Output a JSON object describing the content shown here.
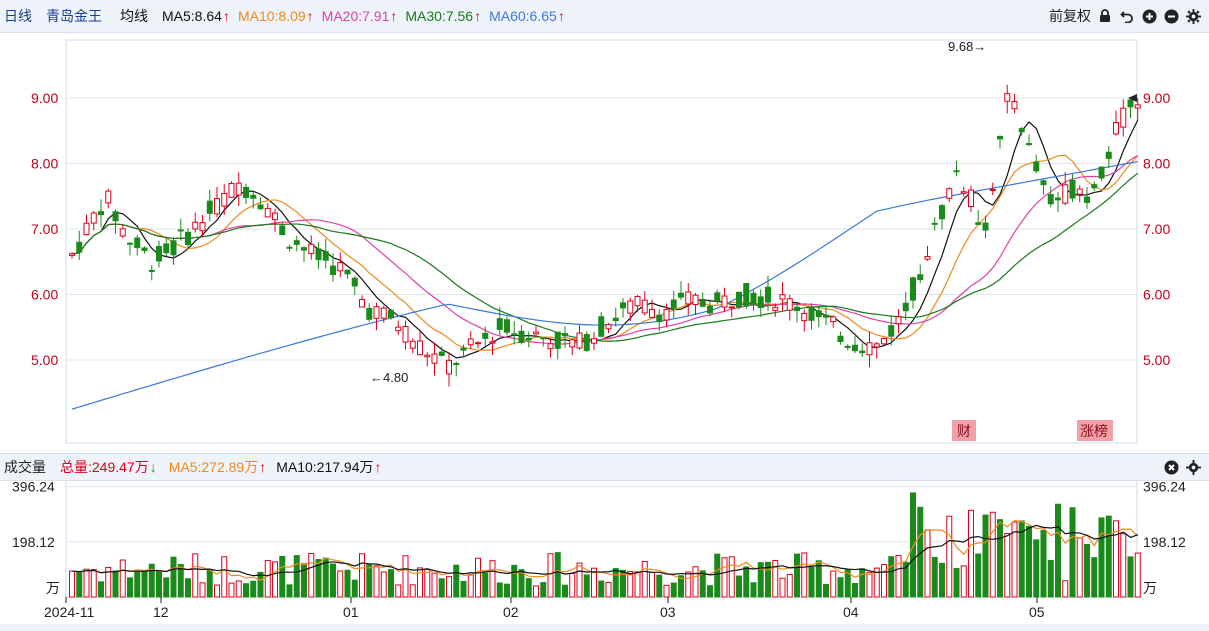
{
  "header": {
    "period": "日线",
    "stock_name": "青岛金王",
    "ma_title": "均线",
    "ma5": "MA5:8.64",
    "ma10": "MA10:8.09",
    "ma20": "MA20:7.91",
    "ma30": "MA30:7.56",
    "ma60": "MA60:6.65",
    "adjust": "前复权"
  },
  "volume_header": {
    "title": "成交量",
    "total": "总量:249.47万",
    "ma5": "MA5:272.89万",
    "ma10": "MA10:217.94万"
  },
  "colors": {
    "up": "#e0001b",
    "down": "#1a8a1a",
    "ma5": "#111111",
    "ma10": "#f08a1c",
    "ma20": "#e040a8",
    "ma30": "#1a7a1a",
    "ma60": "#3a7ad8"
  },
  "chart_data": [
    {
      "type": "candlestick",
      "y_ticks": [
        "5.00",
        "6.00",
        "7.00",
        "8.00",
        "9.00"
      ],
      "ylim": [
        4.0,
        9.9
      ],
      "annotations": {
        "high": "9.68→",
        "low": "←4.80",
        "badge1": "财",
        "badge2": "涨榜"
      },
      "grid": true
    },
    {
      "type": "bar",
      "y_ticks": [
        "396.24",
        "198.12"
      ],
      "unit": "万",
      "ylim": [
        0,
        420
      ],
      "x_labels": [
        "2024-11",
        "12",
        "01",
        "02",
        "03",
        "04",
        "05"
      ]
    }
  ]
}
